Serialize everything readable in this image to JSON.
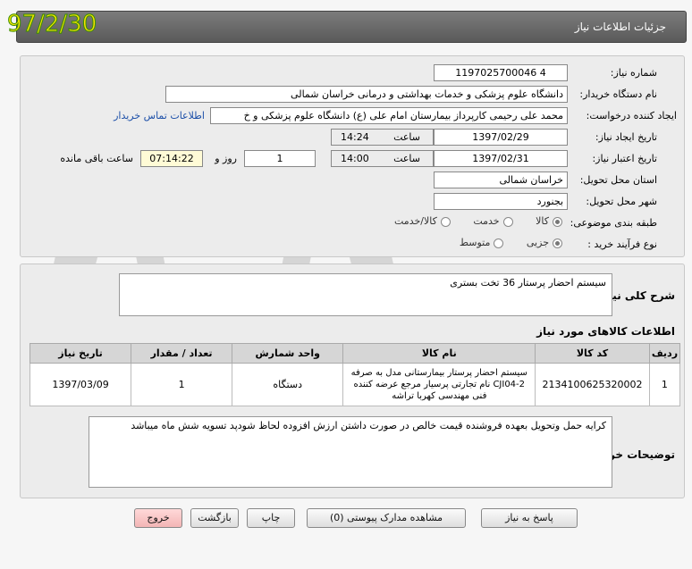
{
  "date_stamp": "97/2/30",
  "header": {
    "title": "جزئیات اطلاعات نیاز"
  },
  "form": {
    "need_number": {
      "label": "شماره نیاز:",
      "value": "1197025700046 4"
    },
    "buyer_org": {
      "label": "نام دستگاه خریدار:",
      "value": "دانشگاه علوم پزشکی و خدمات بهداشتی و درمانی خراسان شمالی"
    },
    "requester": {
      "label": "ایجاد کننده درخواست:",
      "value": "محمد علی رحیمی کارپرداز بیمارستان امام علی (ع) دانشگاه علوم پزشکی و خ",
      "contact_link": "اطلاعات تماس خریدار"
    },
    "created": {
      "label": "تاریخ ایجاد نیاز:",
      "date": "1397/02/29",
      "time_label": "ساعت",
      "time": "14:24"
    },
    "valid_until": {
      "label": "تاریخ اعتبار نیاز:",
      "date": "1397/02/31",
      "time_label": "ساعت",
      "time": "14:00",
      "days": "1",
      "days_label": "روز و",
      "remaining": "07:14:22",
      "remaining_label": "ساعت باقی مانده"
    },
    "province": {
      "label": "استان محل تحویل:",
      "value": "خراسان شمالی"
    },
    "city": {
      "label": "شهر محل تحویل:",
      "value": "بجنورد"
    },
    "category": {
      "label": "طبقه بندی موضوعی:",
      "options": [
        "کالا",
        "خدمت",
        "کالا/خدمت"
      ],
      "selected": "کالا"
    },
    "process": {
      "label": "نوع فرآیند خرید :",
      "options": [
        "جزیی",
        "متوسط"
      ],
      "selected": "جزیی"
    }
  },
  "summary": {
    "label": "شرح کلی نیاز:",
    "value": "سیستم احضار پرستار 36 تخت بستری"
  },
  "goods": {
    "title": "اطلاعات کالاهای مورد نیاز",
    "columns": [
      "ردیف",
      "کد کالا",
      "نام کالا",
      "واحد شمارش",
      "تعداد / مقدار",
      "تاریخ نیاز"
    ],
    "rows": [
      {
        "row": "1",
        "code": "2134100625320002",
        "name": "سیستم احضار پرستار بیمارستانی مدل به صرفه CJI04-2 نام تجارتی پرسیار مرجع عرضه کننده فنی مهندسی کهربا تراشه",
        "unit": "دستگاه",
        "qty": "1",
        "date": "1397/03/09"
      }
    ]
  },
  "buyer_notes": {
    "label": "توضیحات خریدار:",
    "value": "کرایه حمل وتحویل بعهده فروشنده  قیمت خالص در صورت داشتن ارزش افزوده لحاظ شودپد تسویه شش ماه میباشد"
  },
  "buttons": {
    "reply": "پاسخ به نیاز",
    "attachments": "مشاهده مدارک پیوستی (0)",
    "print": "چاپ",
    "back": "بازگشت",
    "exit": "خروج"
  },
  "colors": {
    "title_bar": "#6b6b6b",
    "link": "#1c4fa8",
    "stamp_fill": "#f5e100",
    "stamp_outline": "#3a8f00"
  }
}
